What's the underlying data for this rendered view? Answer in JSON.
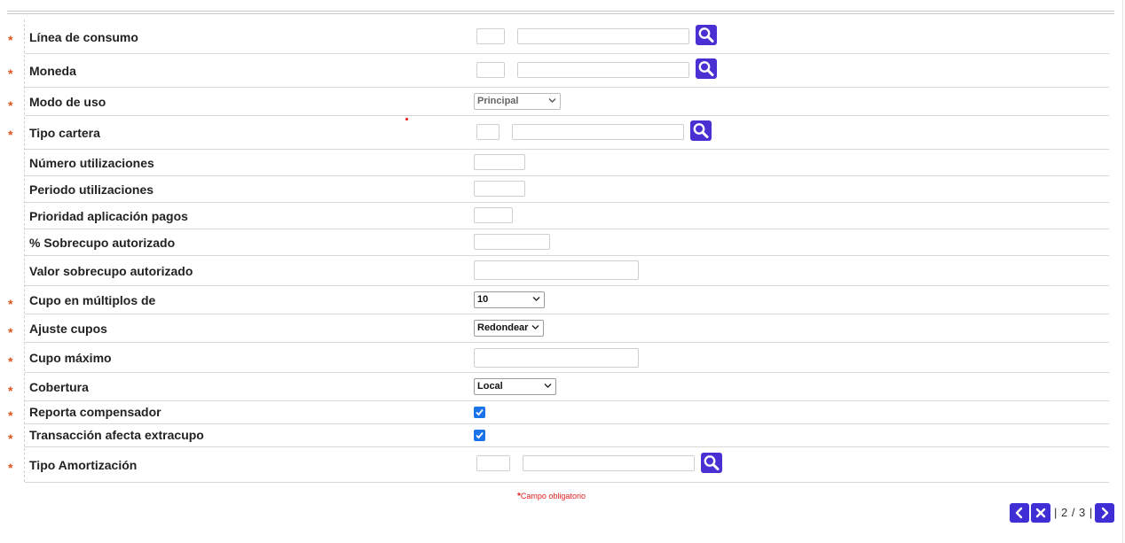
{
  "form": {
    "rows": [
      {
        "label": "Línea de consumo",
        "required": true
      },
      {
        "label": "Moneda",
        "required": true
      },
      {
        "label": "Modo de uso",
        "required": true,
        "select_value": "Principal"
      },
      {
        "label": "Tipo cartera",
        "required": true
      },
      {
        "label": "Número utilizaciones",
        "required": false
      },
      {
        "label": "Periodo utilizaciones",
        "required": false
      },
      {
        "label": "Prioridad aplicación pagos",
        "required": false
      },
      {
        "label": "% Sobrecupo autorizado",
        "required": false
      },
      {
        "label": "Valor sobrecupo autorizado",
        "required": false
      },
      {
        "label": "Cupo en múltiplos de",
        "required": true,
        "select_value": "10"
      },
      {
        "label": "Ajuste cupos",
        "required": true,
        "select_value": "Redondear"
      },
      {
        "label": "Cupo máximo",
        "required": true
      },
      {
        "label": "Cobertura",
        "required": true,
        "select_value": "Local"
      },
      {
        "label": "Reporta compensador",
        "required": true,
        "checked": true
      },
      {
        "label": "Transacción afecta extracupo",
        "required": true,
        "checked": true
      },
      {
        "label": "Tipo Amortización",
        "required": true
      }
    ],
    "required_marker": "*"
  },
  "footnote": {
    "marker": "*",
    "text": "Campo obligatorio"
  },
  "pager": {
    "text": "| 2 / 3 |"
  },
  "icons": {
    "search": "search-icon",
    "prev": "chevron-left-icon",
    "close": "close-icon",
    "next": "chevron-right-icon"
  },
  "colors": {
    "accent": "#4a30d2",
    "required": "#e0541f",
    "checkbox": "#1a73e8"
  }
}
